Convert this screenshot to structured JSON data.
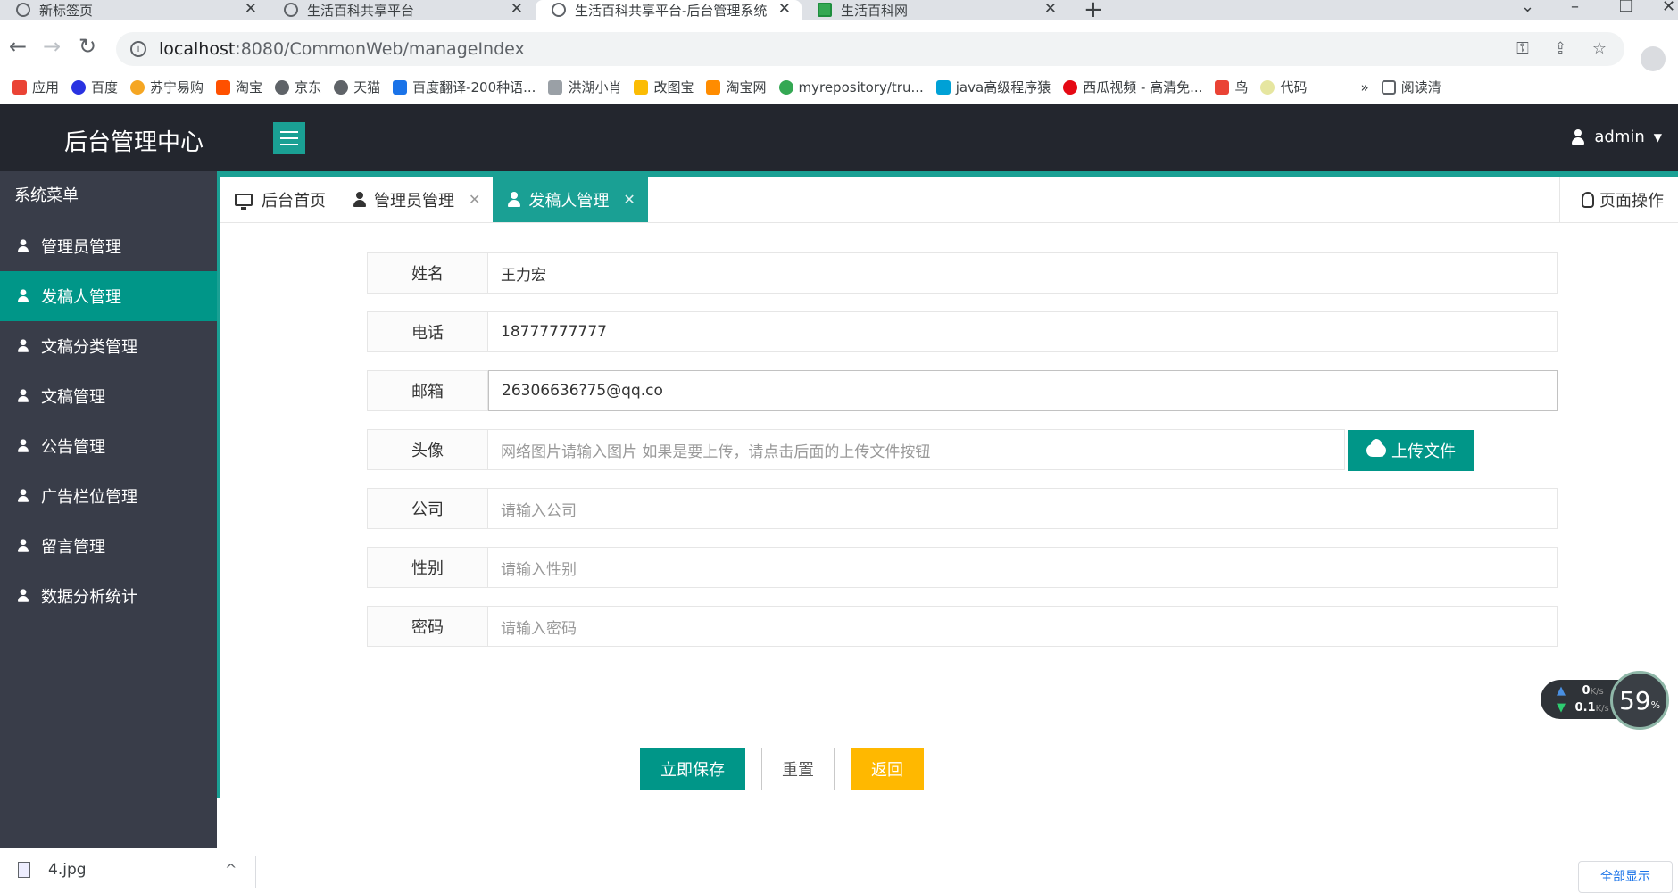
{
  "browser": {
    "tabs": [
      {
        "title": "新标签页"
      },
      {
        "title": "生活百科共享平台"
      },
      {
        "title": "生活百科共享平台-后台管理系统"
      },
      {
        "title": "生活百科网"
      }
    ],
    "url_host": "localhost",
    "url_path": ":8080/CommonWeb/manageIndex",
    "bookmarks": [
      "应用",
      "百度",
      "苏宁易购",
      "淘宝",
      "京东",
      "天猫",
      "百度翻译-200种语...",
      "洪湖小肖",
      "改图宝",
      "淘宝网",
      "myrepository/tru...",
      "java高级程序猿",
      "西瓜视频 - 高清免...",
      "鸟",
      "代码",
      "阅读清"
    ]
  },
  "header": {
    "brand": "后台管理中心",
    "user": "admin"
  },
  "sidebar": {
    "title": "系统菜单",
    "items": [
      {
        "label": "管理员管理"
      },
      {
        "label": "发稿人管理"
      },
      {
        "label": "文稿分类管理"
      },
      {
        "label": "文稿管理"
      },
      {
        "label": "公告管理"
      },
      {
        "label": "广告栏位管理"
      },
      {
        "label": "留言管理"
      },
      {
        "label": "数据分析统计"
      }
    ],
    "active_index": 1
  },
  "page_tabs": [
    {
      "label": "后台首页"
    },
    {
      "label": "管理员管理"
    },
    {
      "label": "发稿人管理"
    }
  ],
  "page_ops": "页面操作",
  "form": {
    "name": {
      "label": "姓名",
      "value": "王力宏"
    },
    "phone": {
      "label": "电话",
      "value": "18777777777"
    },
    "email": {
      "label": "邮箱",
      "value": "26306636?75@qq.co"
    },
    "avatar": {
      "label": "头像",
      "placeholder": "网络图片请输入图片 如果是要上传，请点击后面的上传文件按钮",
      "upload_label": "上传文件"
    },
    "company": {
      "label": "公司",
      "placeholder": "请输入公司"
    },
    "gender": {
      "label": "性别",
      "placeholder": "请输入性别"
    },
    "password": {
      "label": "密码",
      "placeholder": "请输入密码"
    },
    "buttons": {
      "save": "立即保存",
      "reset": "重置",
      "back": "返回"
    }
  },
  "speed_widget": {
    "up": "0",
    "up_unit": "K/s",
    "down": "0.1",
    "down_unit": "K/s",
    "percent": "59",
    "percent_unit": "%"
  },
  "downloads": {
    "file": "4.jpg",
    "show_all": "全部显示"
  },
  "colors": {
    "primary": "#009688",
    "accent": "#1aa094",
    "warn": "#ffb800",
    "header": "#23262e",
    "sidebar": "#393d49"
  }
}
